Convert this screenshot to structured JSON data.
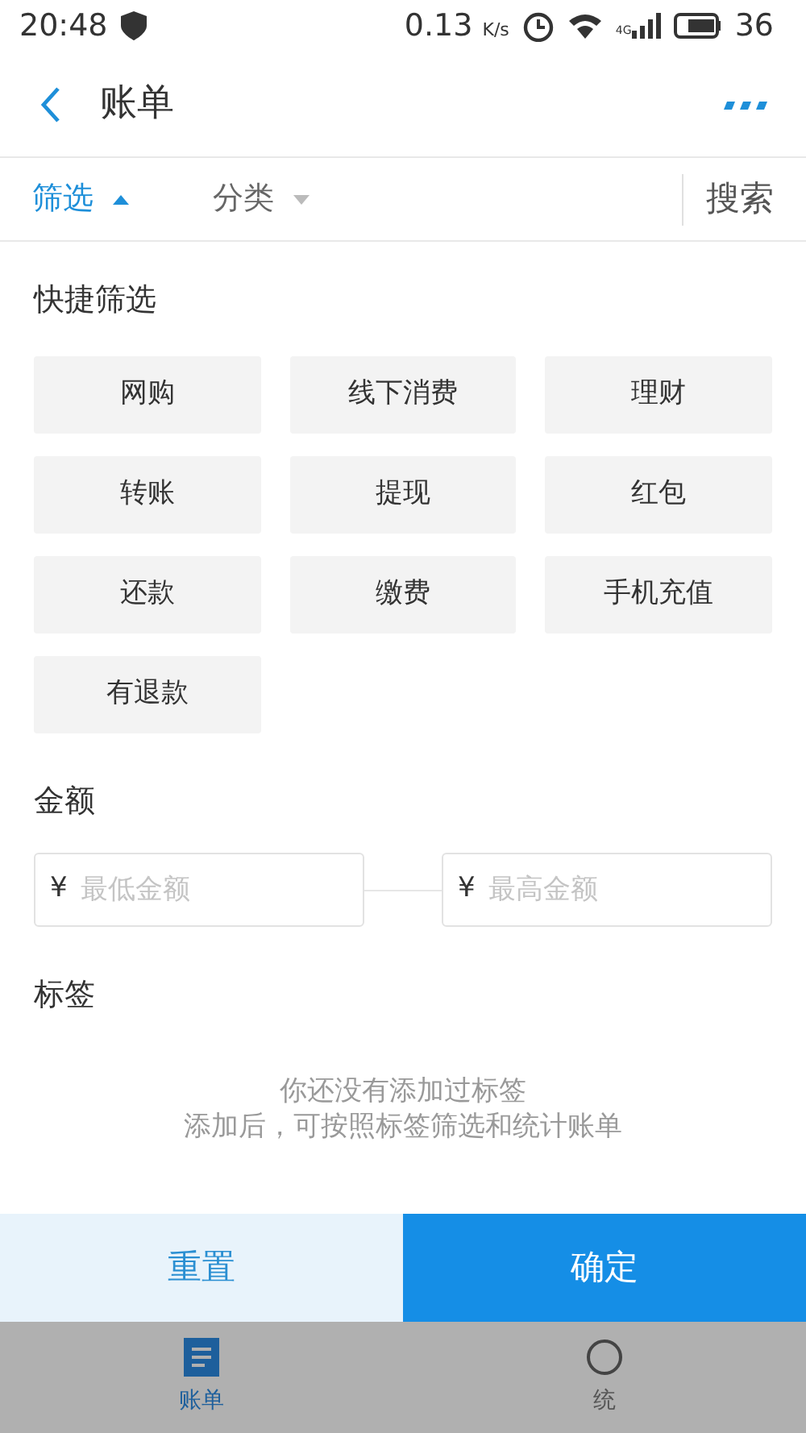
{
  "status_bar": {
    "time": "20:48",
    "speed": "0.13",
    "speed_unit": "K/s",
    "network": "4G",
    "battery": "36"
  },
  "header": {
    "title": "账单"
  },
  "filter_tabs": [
    {
      "label": "筛选",
      "selected": true
    },
    {
      "label": "分类",
      "selected": false
    }
  ],
  "search": "搜索",
  "quick_filter": {
    "title": "快捷筛选",
    "options": [
      "网购",
      "线下消费",
      "理财",
      "转账",
      "提现",
      "红包",
      "还款",
      "缴费",
      "手机充值",
      "有退款"
    ]
  },
  "amount": {
    "title": "金额",
    "currency": "¥",
    "min_placeholder": "最低金额",
    "max_placeholder": "最高金额"
  },
  "tags": {
    "title": "标签",
    "empty_lines": [
      "你还没有添加过标签",
      "添加后，可按照标签筛选和统计账单"
    ]
  },
  "actions": [
    {
      "label": "重置",
      "kind": "secondary"
    },
    {
      "label": "确定",
      "kind": "primary"
    }
  ],
  "bottom_nav": [
    {
      "label": "账单",
      "kind": "list",
      "selected": true
    },
    {
      "label": "统",
      "kind": "circle",
      "selected": false
    }
  ]
}
